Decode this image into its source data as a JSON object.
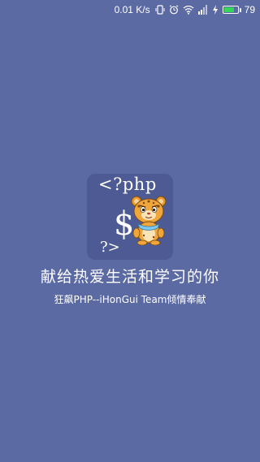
{
  "status_bar": {
    "network_speed": "0.01 K/s",
    "battery_level": "79",
    "battery_fraction": 0.79,
    "icons": [
      "vibrate-icon",
      "alarm-icon",
      "wifi-icon",
      "signal-icon",
      "charging-icon",
      "battery-icon"
    ],
    "battery_color": "#35d65a"
  },
  "splash": {
    "logo_php_text": "<?php",
    "logo_dollar_text": "$",
    "logo_close_text": "?>",
    "mascot": "tiger-mascot-icon",
    "title": "献给热爱生活和学习的你",
    "subtitle": "狂飙PHP--iHonGui Team倾情奉献",
    "background_color": "#5c6aa4",
    "logo_tile_color": "#4d5a93"
  }
}
